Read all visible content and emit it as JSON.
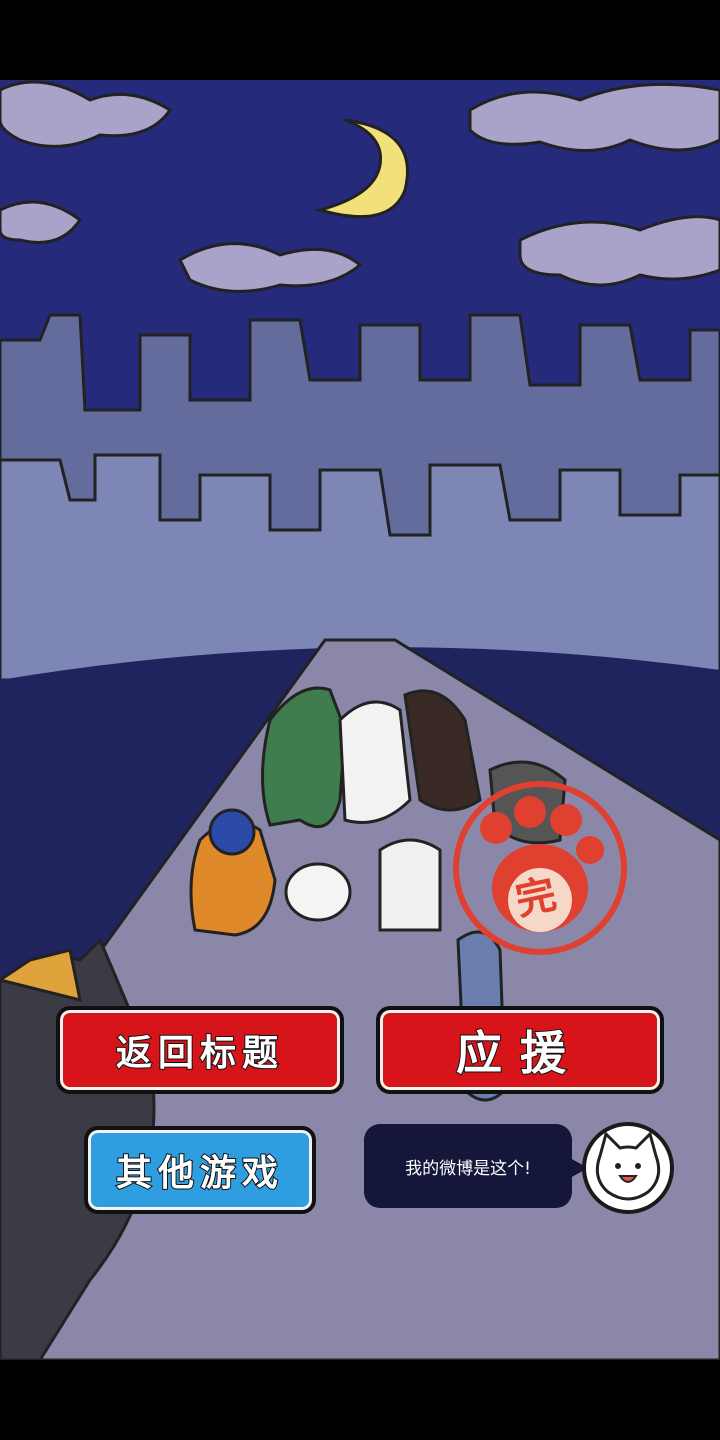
{
  "buttons": {
    "back_to_title": "返回标题",
    "cheer": "应援",
    "other_games": "其他游戏"
  },
  "bubble": {
    "text": "我的微博是这个!"
  },
  "stamp": {
    "text": "完"
  },
  "colors": {
    "sky": "#262a7a",
    "city": "#7d86b4",
    "road": "#8a87a8",
    "red_button": "#d8141b",
    "blue_button": "#2f9ee0",
    "moon": "#f2e07a"
  }
}
